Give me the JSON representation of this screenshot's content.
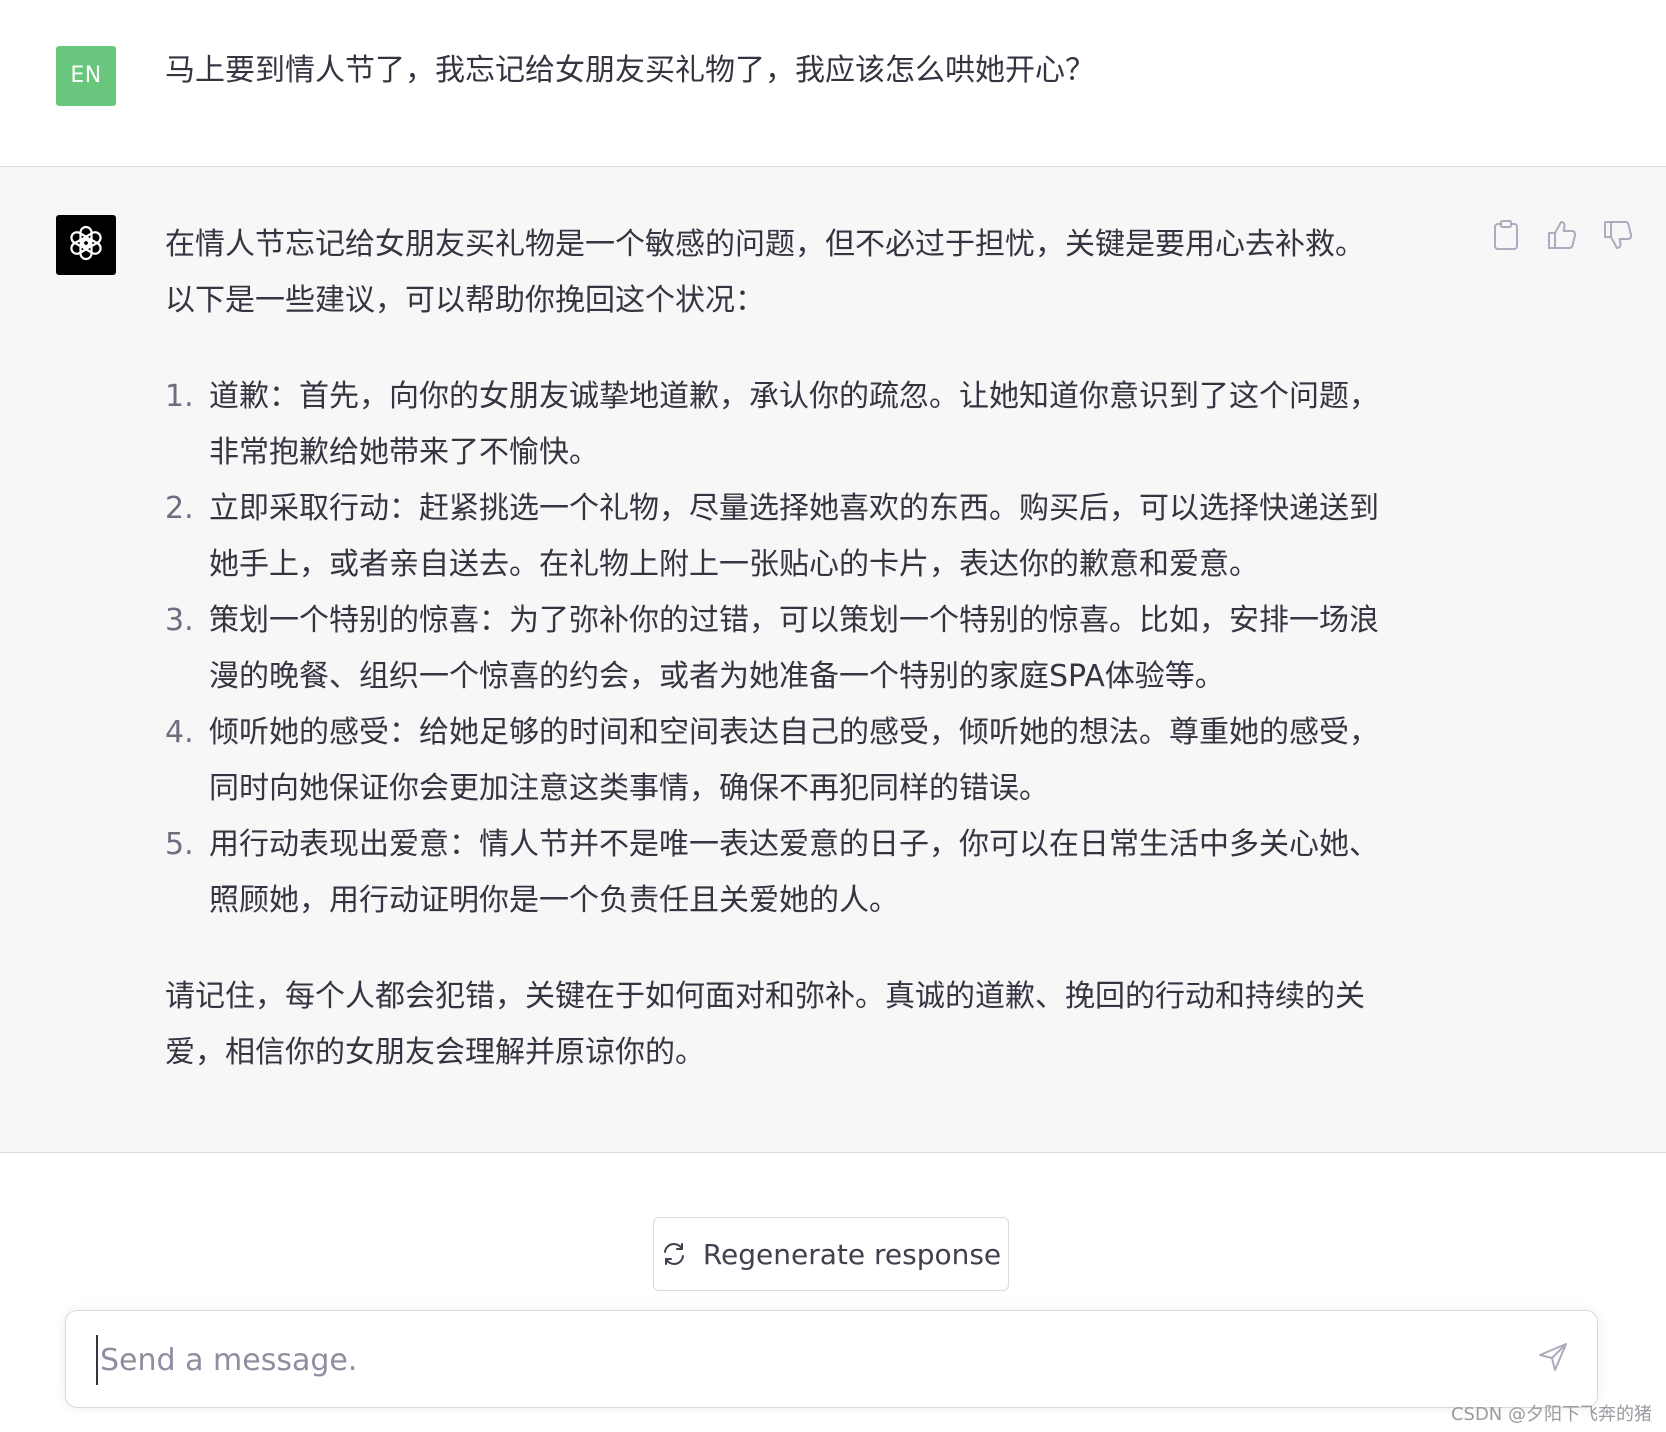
{
  "user_message": {
    "avatar_label": "EN",
    "text": "马上要到情人节了，我忘记给女朋友买礼物了，我应该怎么哄她开心？"
  },
  "assistant_message": {
    "avatar_icon": "openai-logo-icon",
    "intro_line1": "在情人节忘记给女朋友买礼物是一个敏感的问题，但不必过于担忧，关键是要用心去补救。",
    "intro_line2": "以下是一些建议，可以帮助你挽回这个状况：",
    "items": [
      {
        "number": "1.",
        "line1": "道歉：首先，向你的女朋友诚挚地道歉，承认你的疏忽。让她知道你意识到了这个问题，",
        "line2": "非常抱歉给她带来了不愉快。"
      },
      {
        "number": "2.",
        "line1": "立即采取行动：赶紧挑选一个礼物，尽量选择她喜欢的东西。购买后，可以选择快递送到",
        "line2": "她手上，或者亲自送去。在礼物上附上一张贴心的卡片，表达你的歉意和爱意。"
      },
      {
        "number": "3.",
        "line1": "策划一个特别的惊喜：为了弥补你的过错，可以策划一个特别的惊喜。比如，安排一场浪",
        "line2": "漫的晚餐、组织一个惊喜的约会，或者为她准备一个特别的家庭SPA体验等。"
      },
      {
        "number": "4.",
        "line1": "倾听她的感受：给她足够的时间和空间表达自己的感受，倾听她的想法。尊重她的感受，",
        "line2": "同时向她保证你会更加注意这类事情，确保不再犯同样的错误。"
      },
      {
        "number": "5.",
        "line1": "用行动表现出爱意：情人节并不是唯一表达爱意的日子，你可以在日常生活中多关心她、",
        "line2": "照顾她，用行动证明你是一个负责任且关爱她的人。"
      }
    ],
    "outro_line1": "请记住，每个人都会犯错，关键在于如何面对和弥补。真诚的道歉、挽回的行动和持续的关",
    "outro_line2": "爱，相信你的女朋友会理解并原谅你的。",
    "actions": [
      "copy-icon",
      "thumbs-up-icon",
      "thumbs-down-icon"
    ]
  },
  "regenerate": {
    "label": "Regenerate response",
    "icon": "refresh-icon"
  },
  "composer": {
    "placeholder": "Send a message.",
    "value": "",
    "send_icon": "send-icon"
  },
  "watermark": "CSDN @夕阳下飞奔的猪",
  "colors": {
    "user_avatar_bg": "#68c77c",
    "assistant_avatar_bg": "#000000",
    "assistant_row_bg": "#f7f7f8",
    "text": "#343541",
    "muted": "#6e6e80"
  }
}
